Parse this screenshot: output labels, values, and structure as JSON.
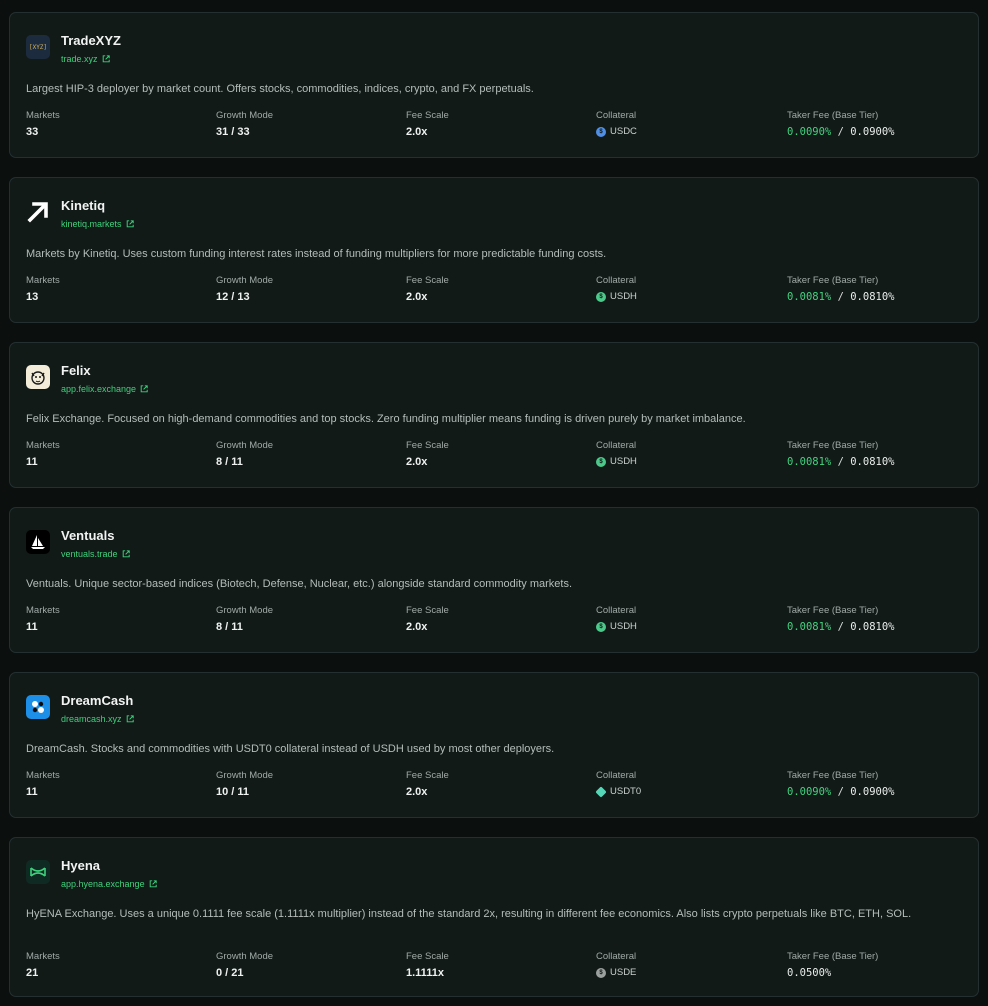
{
  "labels": {
    "markets": "Markets",
    "growth_mode": "Growth Mode",
    "fee_scale": "Fee Scale",
    "collateral": "Collateral",
    "taker_fee": "Taker Fee (Base Tier)",
    "fee_separator": " / "
  },
  "deployers": [
    {
      "name": "TradeXYZ",
      "link": "trade.xyz",
      "logo": "tradexyz-logo",
      "logo_text": "[XYZ]",
      "description": "Largest HIP-3 deployer by market count. Offers stocks, commodities, indices, crypto, and FX perpetuals.",
      "markets": "33",
      "growth_mode": "31 / 33",
      "fee_scale": "2.0x",
      "collateral": "USDC",
      "collateral_icon": "usdc-icon",
      "collateral_color": "#4f8fe6",
      "taker_fee_growth": "0.0090%",
      "taker_fee_base": "0.0900%"
    },
    {
      "name": "Kinetiq",
      "link": "kinetiq.markets",
      "logo": "kinetiq-arrow-logo",
      "description": "Markets by Kinetiq. Uses custom funding interest rates instead of funding multipliers for more predictable funding costs.",
      "markets": "13",
      "growth_mode": "12 / 13",
      "fee_scale": "2.0x",
      "collateral": "USDH",
      "collateral_icon": "usdh-icon",
      "collateral_color": "#4cc98a",
      "taker_fee_growth": "0.0081%",
      "taker_fee_base": "0.0810%"
    },
    {
      "name": "Felix",
      "link": "app.felix.exchange",
      "logo": "felix-cat-logo",
      "description": "Felix Exchange. Focused on high-demand commodities and top stocks. Zero funding multiplier means funding is driven purely by market imbalance.",
      "markets": "11",
      "growth_mode": "8 / 11",
      "fee_scale": "2.0x",
      "collateral": "USDH",
      "collateral_icon": "usdh-icon",
      "collateral_color": "#4cc98a",
      "taker_fee_growth": "0.0081%",
      "taker_fee_base": "0.0810%"
    },
    {
      "name": "Ventuals",
      "link": "ventuals.trade",
      "logo": "ventuals-ship-logo",
      "description": "Ventuals. Unique sector-based indices (Biotech, Defense, Nuclear, etc.) alongside standard commodity markets.",
      "markets": "11",
      "growth_mode": "8 / 11",
      "fee_scale": "2.0x",
      "collateral": "USDH",
      "collateral_icon": "usdh-icon",
      "collateral_color": "#4cc98a",
      "taker_fee_growth": "0.0081%",
      "taker_fee_base": "0.0810%"
    },
    {
      "name": "DreamCash",
      "link": "dreamcash.xyz",
      "logo": "dreamcash-logo",
      "description": "DreamCash. Stocks and commodities with USDT0 collateral instead of USDH used by most other deployers.",
      "markets": "11",
      "growth_mode": "10 / 11",
      "fee_scale": "2.0x",
      "collateral": "USDT0",
      "collateral_icon": "usdt0-gem-icon",
      "collateral_color": "#55d6b6",
      "taker_fee_growth": "0.0090%",
      "taker_fee_base": "0.0900%"
    },
    {
      "name": "Hyena",
      "link": "app.hyena.exchange",
      "logo": "hyena-logo",
      "description": "HyENA Exchange. Uses a unique 0.1111 fee scale (1.1111x multiplier) instead of the standard 2x, resulting in different fee economics. Also lists crypto perpetuals like BTC, ETH, SOL.",
      "markets": "21",
      "growth_mode": "0 / 21",
      "fee_scale": "1.1111x",
      "collateral": "USDE",
      "collateral_icon": "usde-icon",
      "collateral_color": "#9aa09e",
      "taker_fee_growth": "",
      "taker_fee_base": "0.0500%"
    }
  ]
}
